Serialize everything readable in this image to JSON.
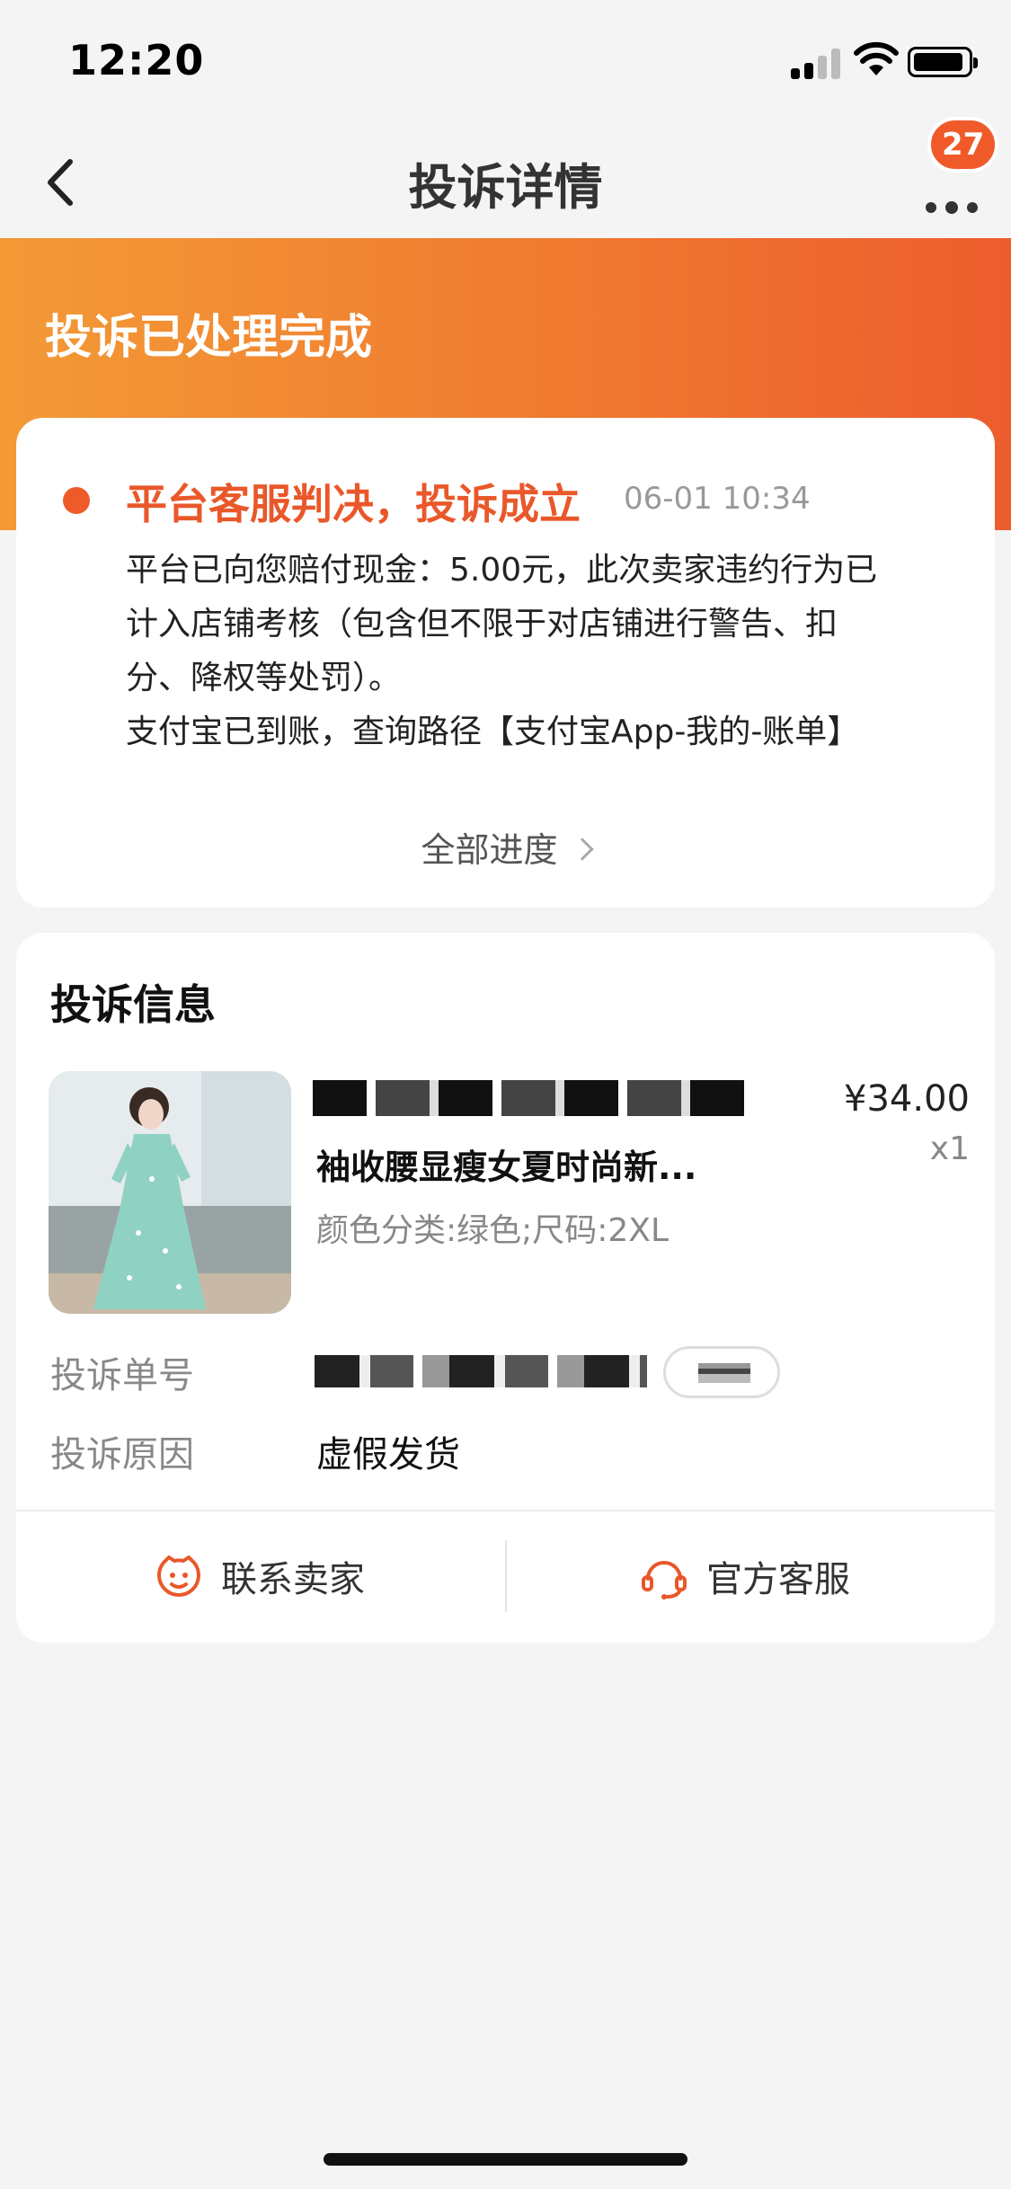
{
  "status_bar": {
    "time": "12:20"
  },
  "nav": {
    "title": "投诉详情",
    "badge_count": "27",
    "back_icon": "chevron-left-icon",
    "more_icon": "more-dots-icon"
  },
  "banner": {
    "title": "投诉已处理完成"
  },
  "progress": {
    "verdict": "平台客服判决，投诉成立",
    "time": "06-01 10:34",
    "lines": [
      "平台已向您赔付现金：5.00元，此次卖家违约行为已",
      "计入店铺考核（包含但不限于对店铺进行警告、扣",
      "分、降权等处罚）。",
      "支付宝已到账，查询路径【支付宝App-我的-账单】"
    ],
    "all_progress": "全部进度"
  },
  "complaint_info": {
    "section_title": "投诉信息",
    "product": {
      "title": "袖收腰显瘦女夏时尚新...",
      "spec": "颜色分类:绿色;尺码:2XL",
      "price": "¥34.00",
      "qty": "x1"
    },
    "rows": [
      {
        "label": "投诉单号",
        "value": ""
      },
      {
        "label": "投诉原因",
        "value": "虚假发货"
      }
    ],
    "actions": [
      {
        "label": "联系卖家",
        "icon": "seller-face-icon"
      },
      {
        "label": "官方客服",
        "icon": "headset-icon"
      }
    ]
  },
  "colors": {
    "accent": "#e9582a",
    "banner_start": "#f39a36",
    "banner_end": "#ec5d2d"
  }
}
